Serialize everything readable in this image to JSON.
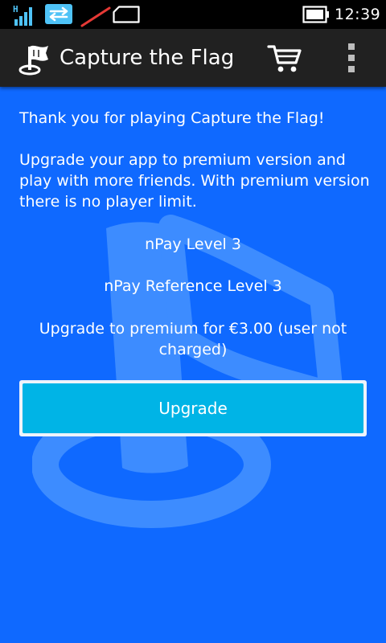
{
  "status_bar": {
    "network_type": "H",
    "time": "12:39",
    "icons": [
      "signal-icon",
      "data-transfer-icon",
      "wifi-off-icon",
      "sim-icon",
      "battery-icon"
    ]
  },
  "action_bar": {
    "title": "Capture the Flag",
    "logo_icon": "flag-logo-icon",
    "cart_icon": "shopping-cart-icon",
    "overflow_icon": "overflow-menu-icon"
  },
  "main": {
    "thank_you": "Thank you for playing Capture the Flag!",
    "upgrade_pitch": "Upgrade your app to premium version and play with more friends. With premium version there is no player limit.",
    "npay_level": "nPay Level 3",
    "npay_reference_level": "nPay Reference Level 3",
    "price_info": "Upgrade to premium for €3.00 (user not charged)",
    "upgrade_button": "Upgrade"
  },
  "colors": {
    "background": "#0f69ff",
    "action_bar": "#212121",
    "button": "#00b4e6",
    "button_border": "#eef3fa",
    "watermark": "#3d8cff"
  }
}
